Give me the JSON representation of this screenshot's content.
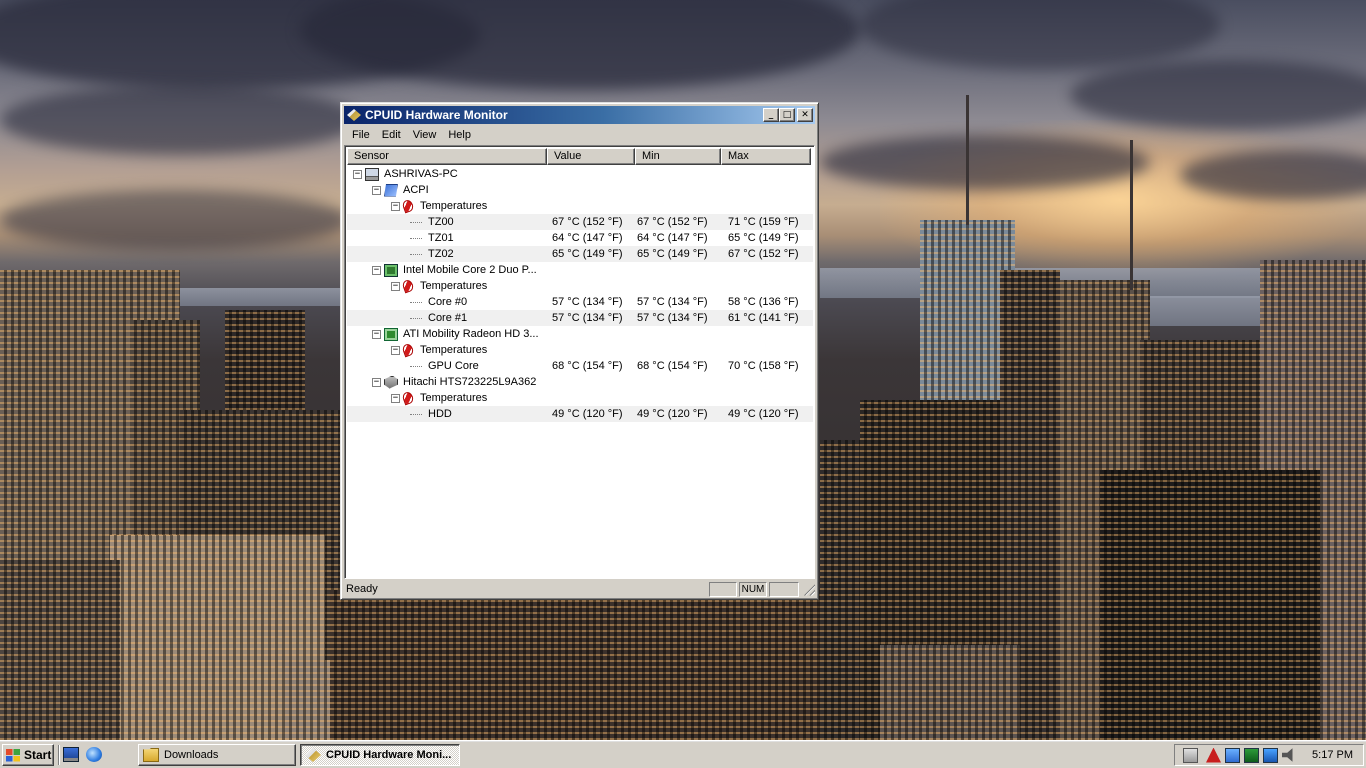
{
  "window": {
    "title": "CPUID Hardware Monitor",
    "controls": {
      "minimize": "_",
      "maximize": "□",
      "close": "✕"
    },
    "menu": [
      "File",
      "Edit",
      "View",
      "Help"
    ],
    "columns": [
      "Sensor",
      "Value",
      "Min",
      "Max"
    ],
    "rows": [
      {
        "level": 0,
        "expander": "−",
        "icon": "computer-icon",
        "label": "ASHRIVAS-PC",
        "value": "",
        "min": "",
        "max": ""
      },
      {
        "level": 1,
        "expander": "−",
        "icon": "acpi-icon",
        "label": "ACPI",
        "value": "",
        "min": "",
        "max": ""
      },
      {
        "level": 2,
        "expander": "−",
        "icon": "thermometer-icon",
        "label": "Temperatures",
        "value": "",
        "min": "",
        "max": ""
      },
      {
        "level": 3,
        "expander": "",
        "icon": "",
        "label": "TZ00",
        "value": "67 °C  (152 °F)",
        "min": "67 °C  (152 °F)",
        "max": "71 °C  (159 °F)"
      },
      {
        "level": 3,
        "expander": "",
        "icon": "",
        "label": "TZ01",
        "value": "64 °C  (147 °F)",
        "min": "64 °C  (147 °F)",
        "max": "65 °C  (149 °F)"
      },
      {
        "level": 3,
        "expander": "",
        "icon": "",
        "label": "TZ02",
        "value": "65 °C  (149 °F)",
        "min": "65 °C  (149 °F)",
        "max": "67 °C  (152 °F)"
      },
      {
        "level": 1,
        "expander": "−",
        "icon": "cpu-icon",
        "label": "Intel Mobile Core 2 Duo P...",
        "value": "",
        "min": "",
        "max": ""
      },
      {
        "level": 2,
        "expander": "−",
        "icon": "thermometer-icon",
        "label": "Temperatures",
        "value": "",
        "min": "",
        "max": ""
      },
      {
        "level": 3,
        "expander": "",
        "icon": "",
        "label": "Core #0",
        "value": "57 °C  (134 °F)",
        "min": "57 °C  (134 °F)",
        "max": "58 °C  (136 °F)"
      },
      {
        "level": 3,
        "expander": "",
        "icon": "",
        "label": "Core #1",
        "value": "57 °C  (134 °F)",
        "min": "57 °C  (134 °F)",
        "max": "61 °C  (141 °F)"
      },
      {
        "level": 1,
        "expander": "−",
        "icon": "gpu-icon",
        "label": "ATI Mobility Radeon HD 3...",
        "value": "",
        "min": "",
        "max": ""
      },
      {
        "level": 2,
        "expander": "−",
        "icon": "thermometer-icon",
        "label": "Temperatures",
        "value": "",
        "min": "",
        "max": ""
      },
      {
        "level": 3,
        "expander": "",
        "icon": "",
        "label": "GPU Core",
        "value": "68 °C  (154 °F)",
        "min": "68 °C  (154 °F)",
        "max": "70 °C  (158 °F)"
      },
      {
        "level": 1,
        "expander": "−",
        "icon": "hard-disk-icon",
        "label": "Hitachi HTS723225L9A362",
        "value": "",
        "min": "",
        "max": ""
      },
      {
        "level": 2,
        "expander": "−",
        "icon": "thermometer-icon",
        "label": "Temperatures",
        "value": "",
        "min": "",
        "max": ""
      },
      {
        "level": 3,
        "expander": "",
        "icon": "",
        "label": "HDD",
        "value": "49 °C  (120 °F)",
        "min": "49 °C  (120 °F)",
        "max": "49 °C  (120 °F)"
      }
    ],
    "status": {
      "text": "Ready",
      "num": "NUM"
    }
  },
  "taskbar": {
    "start_label": "Start",
    "quick_launch": [
      "show-desktop-icon",
      "internet-explorer-icon"
    ],
    "tasks": [
      {
        "label": "Downloads",
        "icon": "folder-icon",
        "active": false
      },
      {
        "label": "CPUID Hardware Moni...",
        "icon": "cpuid-icon",
        "active": true
      }
    ],
    "tray_icons": [
      "printer-icon",
      "adobe-icon",
      "display-icon",
      "network-icon",
      "network-icon",
      "volume-icon"
    ],
    "clock": "5:17 PM"
  }
}
